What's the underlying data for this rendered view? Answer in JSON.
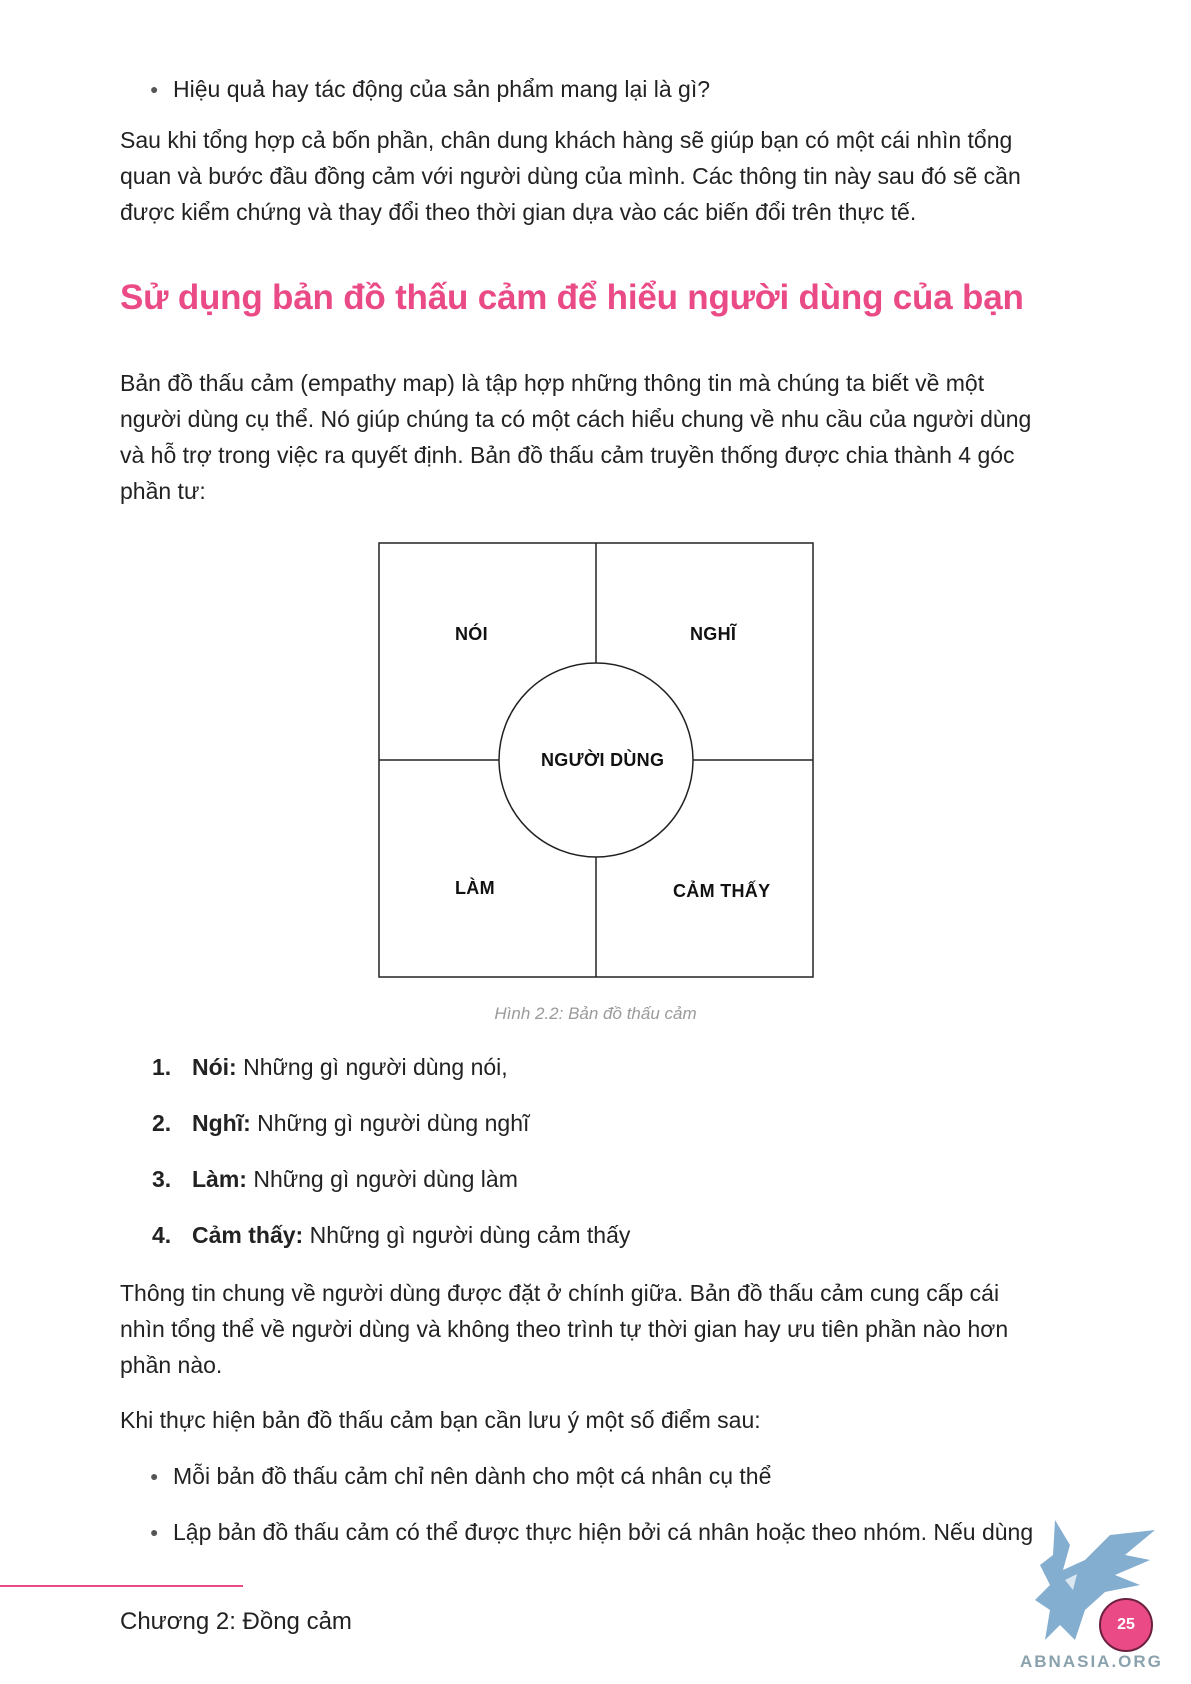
{
  "top_bullet": "Hiệu quả hay tác động của sản phẩm mang lại là gì?",
  "intro_paragraph": [
    "Sau khi tổng hợp cả bốn phần, chân dung khách hàng sẽ giúp bạn có một cái nhìn tổng",
    "quan và bước đầu đồng cảm với người dùng của mình. Các thông tin này sau đó sẽ cần",
    "được kiểm chứng và thay đổi theo thời gian dựa vào các biến đổi trên thực tế."
  ],
  "heading": "Sử dụng bản đồ thấu cảm để hiểu người dùng của bạn",
  "heading_color": "#ea4a86",
  "empathy_paragraph": [
    "Bản đồ thấu cảm (empathy map) là tập hợp những thông tin mà chúng ta biết về một",
    "người dùng cụ thể. Nó giúp chúng ta có một cách hiểu chung về nhu cầu của người dùng",
    "và hỗ trợ trong việc ra quyết định. Bản đồ thấu cảm truyền thống được chia thành 4 góc",
    "phần tư:"
  ],
  "diagram": {
    "top_left": "NÓI",
    "top_right": "NGHĨ",
    "bottom_left": "LÀM",
    "bottom_right": "CẢM THẤY",
    "center": "NGƯỜI DÙNG"
  },
  "caption": "Hình 2.2: Bản đồ thấu cảm",
  "numbered_list": [
    {
      "num": "1.",
      "term": "Nói:",
      "desc": " Những gì người dùng nói,"
    },
    {
      "num": "2.",
      "term": "Nghĩ:",
      "desc": " Những gì người dùng nghĩ"
    },
    {
      "num": "3.",
      "term": "Làm:",
      "desc": " Những gì người dùng làm"
    },
    {
      "num": "4.",
      "term": "Cảm thấy:",
      "desc": " Những gì người dùng cảm thấy"
    }
  ],
  "center_paragraph": [
    "Thông tin chung về người dùng được đặt ở chính giữa. Bản đồ thấu cảm cung cấp cái",
    "nhìn tổng thể về người dùng và không theo trình tự thời gian hay ưu tiên phần nào hơn",
    "phần nào."
  ],
  "notes_intro": "Khi thực hiện bản đồ thấu cảm bạn cần lưu ý một số điểm sau:",
  "notes_bullets": [
    "Mỗi bản đồ thấu cảm chỉ nên dành cho một cá nhân cụ thể",
    "Lập bản đồ thấu cảm có thể được thực hiện bởi cá nhân hoặc theo nhóm. Nếu dùng"
  ],
  "footer": {
    "chapter": "Chương 2: Đồng cảm",
    "page_number": "25",
    "accent_color": "#ea4a86"
  },
  "watermark": {
    "text": "ABNASIA.ORG",
    "icon": "griffin-logo-icon"
  }
}
